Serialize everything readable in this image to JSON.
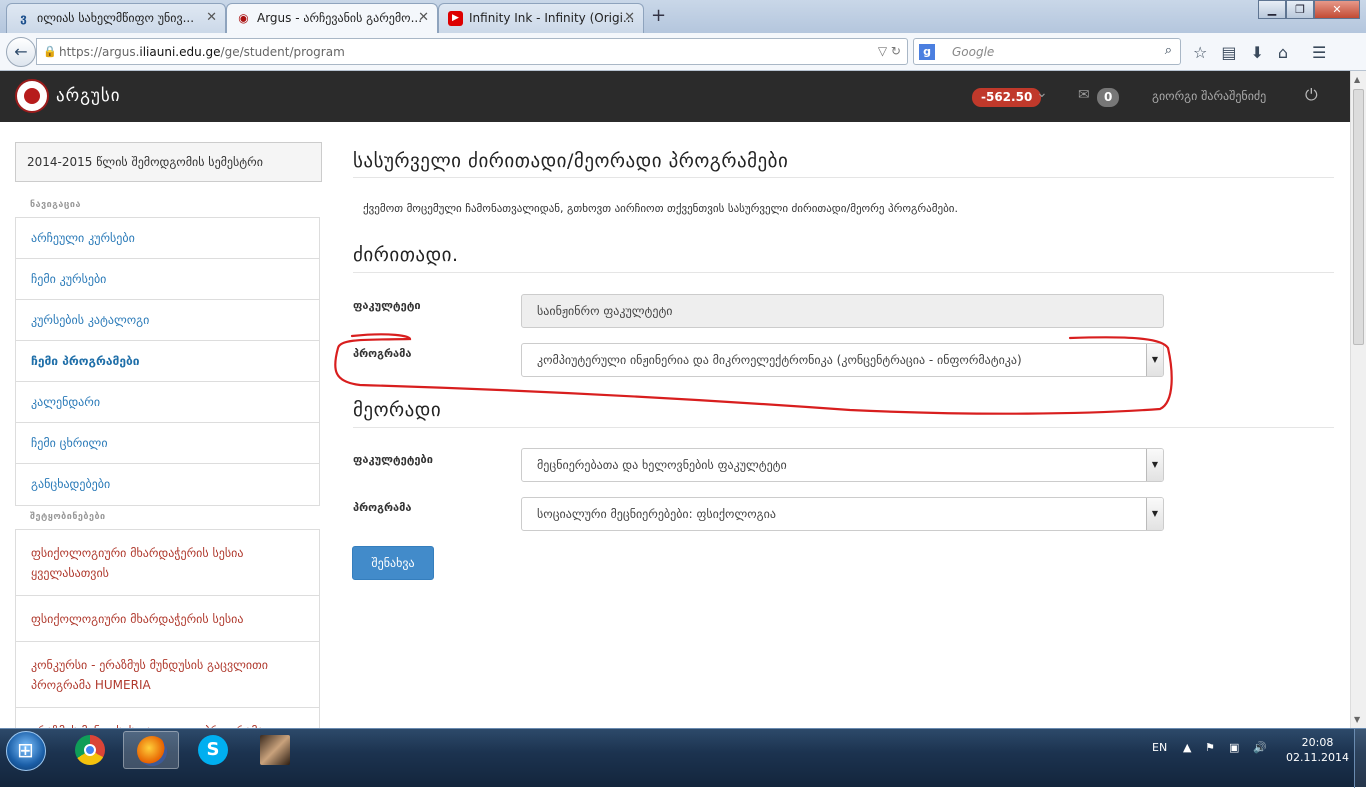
{
  "browser": {
    "tabs": [
      {
        "icon": "ვ",
        "title": "ილიას სახელმწიფო უნივ...",
        "active": false
      },
      {
        "icon": "◉",
        "title": "Argus - არჩევანის გარემო...",
        "active": true
      },
      {
        "icon": "▶",
        "title": "Infinity Ink - Infinity (Origi...",
        "active": false
      }
    ],
    "new_tab": "+",
    "url_prefix": "https://argus.",
    "url_domain": "iliauni.edu.ge",
    "url_path": "/ge/student/program",
    "search_placeholder": "Google",
    "search_engine_letter": "g"
  },
  "header": {
    "brand": "არგუსი",
    "balance": "-562.50",
    "mail_count": "0",
    "username": "გიორგი შარაშენიძე"
  },
  "sidebar": {
    "semester": "2014-2015 წლის შემოდგომის სემესტრი",
    "nav_title": "ნავიგაცია",
    "nav_items": [
      {
        "label": "არჩეული კურსები",
        "active": false
      },
      {
        "label": "ჩემი კურსები",
        "active": false
      },
      {
        "label": "კურსების კატალოგი",
        "active": false
      },
      {
        "label": "ჩემი პროგრამები",
        "active": true
      },
      {
        "label": "კალენდარი",
        "active": false
      },
      {
        "label": "ჩემი ცხრილი",
        "active": false
      },
      {
        "label": "განცხადებები",
        "active": false
      }
    ],
    "announcements_title": "შეტყობინებები",
    "announcements": [
      "ფსიქოლოგიური მხარდაჭერის სესია ყველასათვის",
      "ფსიქოლოგიური მხარდაჭერის სესია",
      "კონკურსი - ერაზმუს მუნდუსის გაცვლითი პროგრამა HUMERIA",
      "ერაზმუს მუნდუსის გაცვლითი პროგრამა"
    ]
  },
  "main": {
    "title": "სასურველი ძირითადი/მეორადი პროგრამები",
    "intro": "ქვემოთ მოცემული ჩამონათვალიდან, გთხოვთ აირჩიოთ თქვენთვის სასურველი ძირითადი/მეორე პროგრამები.",
    "major": {
      "heading": "ძირითადი.",
      "faculty_label": "ფაკულტეტი",
      "faculty_value": "საინჟინრო ფაკულტეტი",
      "program_label": "პროგრამა",
      "program_value": "კომპიუტერული ინჟინერია და მიკროელექტრონიკა (კონცენტრაცია - ინფორმატიკა)"
    },
    "minor": {
      "heading": "მეორადი",
      "faculty_label": "ფაკულტეტები",
      "faculty_value": "მეცნიერებათა და ხელოვნების ფაკულტეტი",
      "program_label": "პროგრამა",
      "program_value": "სოციალური მეცნიერებები: ფსიქოლოგია"
    },
    "save_label": "შენახვა"
  },
  "taskbar": {
    "language": "EN",
    "time": "20:08",
    "date": "02.11.2014"
  },
  "colors": {
    "annotation_red": "#d81e1e",
    "link_blue": "#2a7ab8",
    "announcement_red": "#b03a2e",
    "balance_badge": "#c0392b",
    "primary_button": "#428bca"
  }
}
